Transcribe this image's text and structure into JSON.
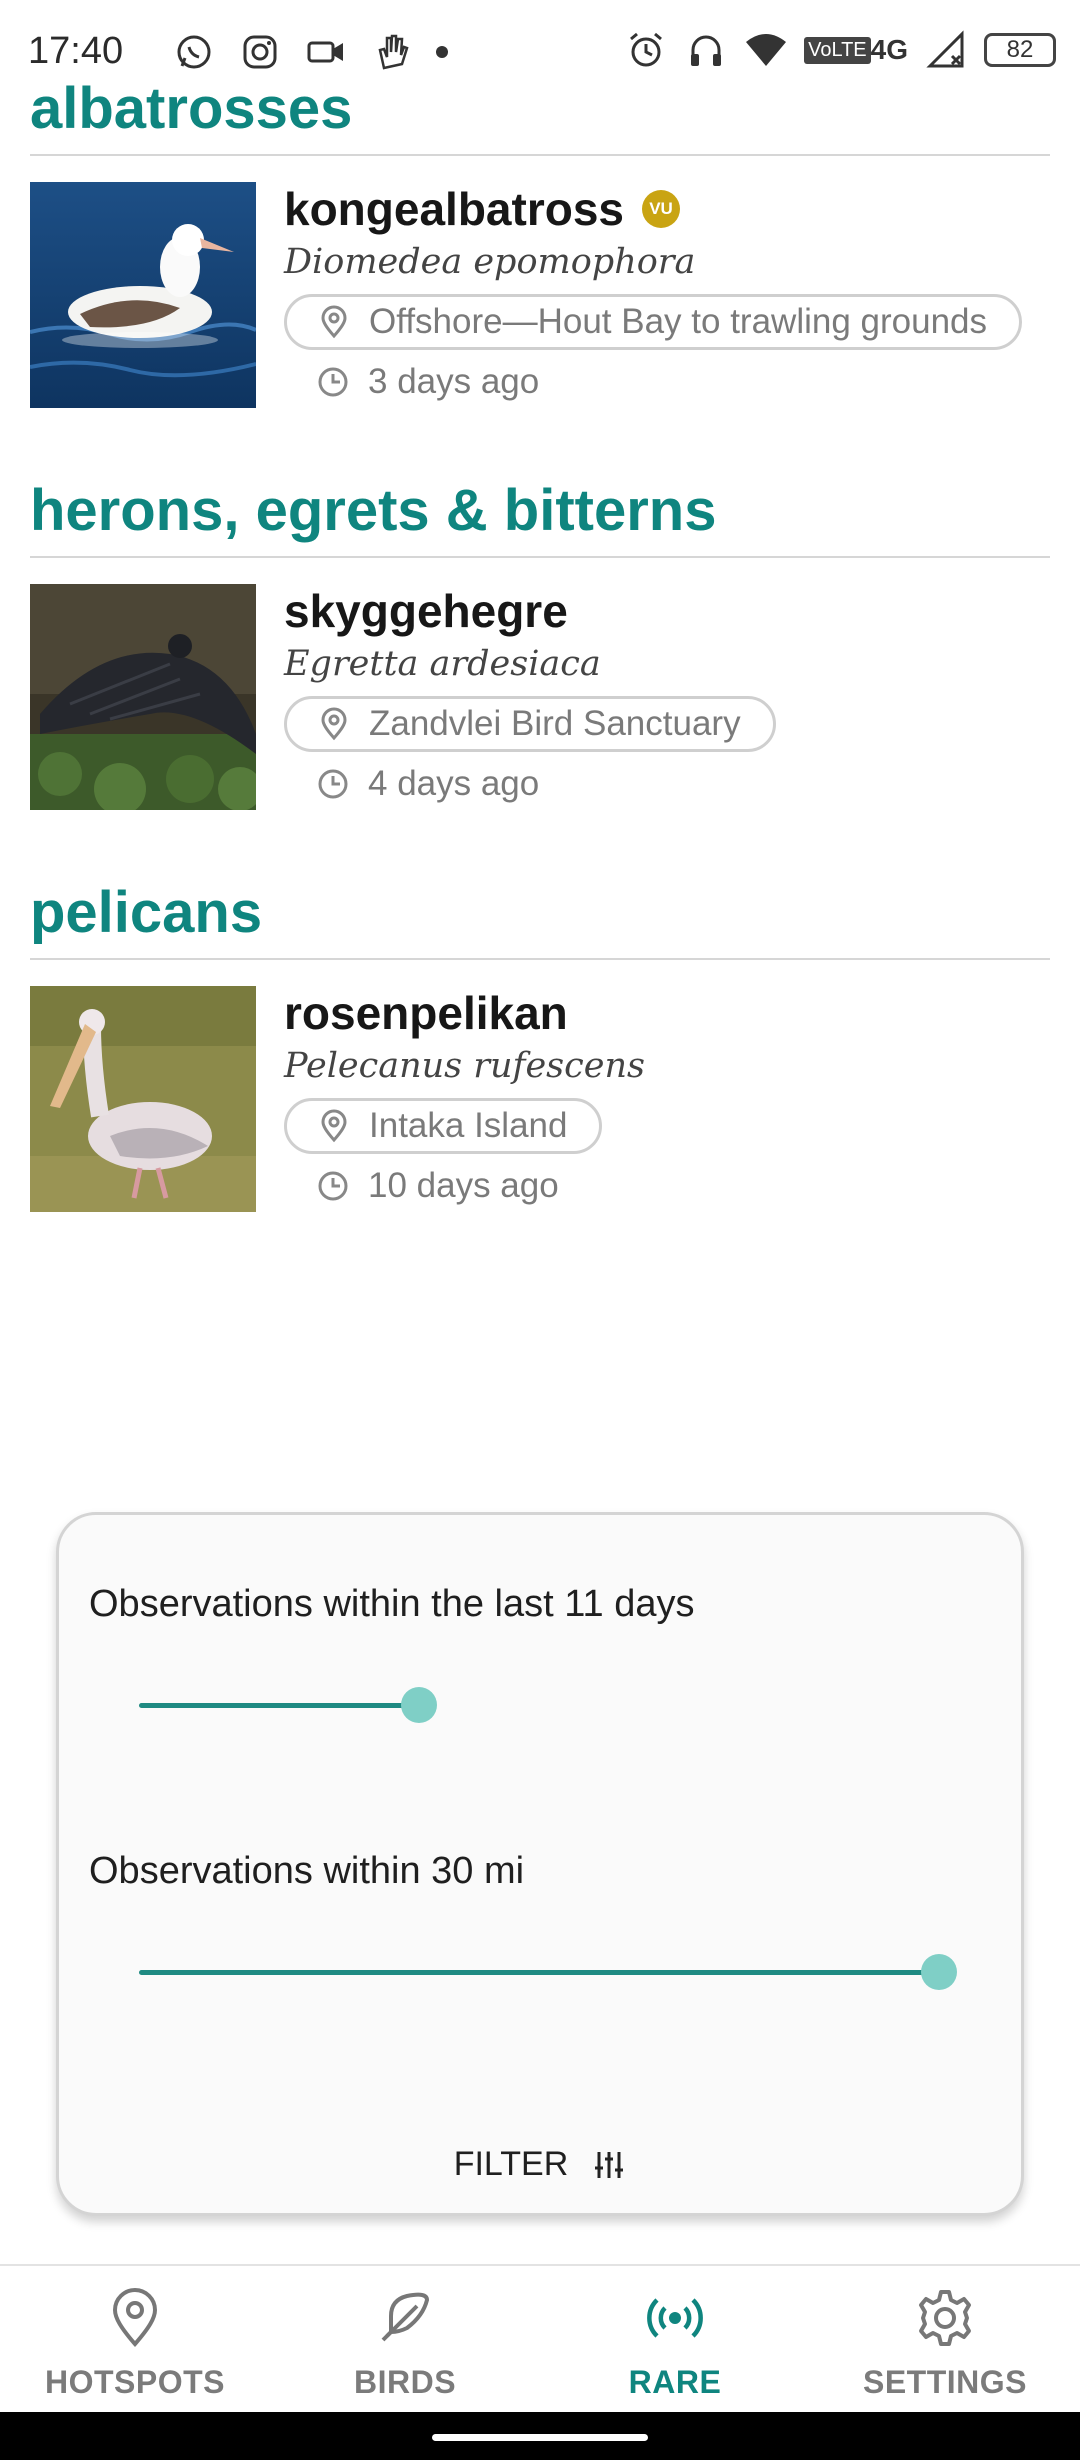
{
  "status_bar": {
    "time": "17:40",
    "network": "4G",
    "volte": "VoLTE",
    "battery": "82",
    "icons": [
      "whatsapp-icon",
      "instagram-icon",
      "video-icon",
      "hand-icon",
      "alarm-icon",
      "headphones-icon",
      "wifi-icon",
      "signal-icon",
      "battery-icon"
    ]
  },
  "sections": [
    {
      "title": "albatrosses",
      "entries": [
        {
          "common_name": "kongealbatross",
          "badge": "VU",
          "scientific_name": "Diomedea epomophora",
          "location": "Offshore—Hout Bay to trawling grounds",
          "time_ago": "3 days ago"
        }
      ]
    },
    {
      "title": "herons, egrets & bitterns",
      "entries": [
        {
          "common_name": "skyggehegre",
          "scientific_name": "Egretta ardesiaca",
          "location": "Zandvlei Bird Sanctuary",
          "time_ago": "4 days ago"
        }
      ]
    },
    {
      "title": "pelicans",
      "entries": [
        {
          "common_name": "rosenpelikan",
          "scientific_name": "Pelecanus rufescens",
          "location": "Intaka Island",
          "time_ago": "10 days ago"
        }
      ]
    }
  ],
  "filter": {
    "days_label": "Observations within the last 11 days",
    "days_slider_fraction": 0.35,
    "distance_label": "Observations within 30 mi",
    "distance_slider_fraction": 1.0,
    "button_label": "FILTER",
    "accent_color": "#1f8a82",
    "thumb_color": "#7fcfc6"
  },
  "bottom_nav": {
    "items": [
      {
        "label": "HOTSPOTS",
        "icon": "map-pin-icon",
        "active": false
      },
      {
        "label": "BIRDS",
        "icon": "feather-icon",
        "active": false
      },
      {
        "label": "RARE",
        "icon": "broadcast-icon",
        "active": true
      },
      {
        "label": "SETTINGS",
        "icon": "gear-icon",
        "active": false
      }
    ],
    "active_color": "#0f857f"
  }
}
